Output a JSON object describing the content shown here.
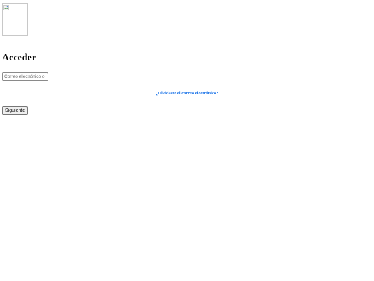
{
  "logo": {
    "icon": "broken-image-icon"
  },
  "page": {
    "title": "Acceder"
  },
  "form": {
    "email_placeholder": "Correo electrónico o teléfono",
    "email_value": "",
    "forgot_label": "¿Olvidaste el correo electrónico?",
    "next_label": "Siguiente"
  }
}
